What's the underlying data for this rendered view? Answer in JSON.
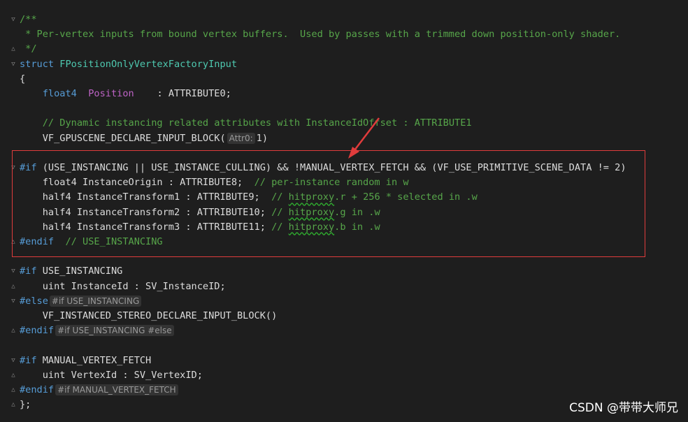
{
  "lines": [
    {
      "parts": [
        [
          "cm",
          "/**"
        ]
      ]
    },
    {
      "parts": [
        [
          "cm",
          " * Per-vertex inputs from bound vertex buffers.  Used by passes with a trimmed down position-only shader."
        ]
      ]
    },
    {
      "parts": [
        [
          "cm",
          " */"
        ]
      ]
    },
    {
      "parts": [
        [
          "kw",
          "struct"
        ],
        [
          "tx",
          " "
        ],
        [
          "ty",
          "FPositionOnlyVertexFactoryInput"
        ]
      ]
    },
    {
      "parts": [
        [
          "tx",
          "{"
        ]
      ]
    },
    {
      "parts": [
        [
          "tx",
          "    "
        ],
        [
          "kw",
          "float4"
        ],
        [
          "tx",
          "  "
        ],
        [
          "mac",
          "Position"
        ],
        [
          "tx",
          "    : ATTRIBUTE0;"
        ]
      ]
    },
    {
      "parts": [
        [
          "tx",
          ""
        ]
      ]
    },
    {
      "parts": [
        [
          "tx",
          "    "
        ],
        [
          "cm",
          "// Dynamic instancing related attributes with InstanceIdOffset : ATTRIBUTE1"
        ]
      ]
    },
    {
      "parts": [
        [
          "tx",
          "    VF_GPUSCENE_DECLARE_INPUT_BLOCK("
        ],
        [
          "hint",
          "Attr0:"
        ],
        [
          "tx",
          "1)"
        ]
      ]
    },
    {
      "parts": [
        [
          "tx",
          ""
        ]
      ]
    },
    {
      "parts": [
        [
          "kw",
          "#if"
        ],
        [
          "tx",
          " (USE_INSTANCING || USE_INSTANCE_CULLING) && !MANUAL_VERTEX_FETCH && (VF_USE_PRIMITIVE_SCENE_DATA != 2)"
        ]
      ]
    },
    {
      "parts": [
        [
          "tx",
          "    float4 InstanceOrigin : ATTRIBUTE8;  "
        ],
        [
          "cm",
          "// per-instance random in w"
        ]
      ]
    },
    {
      "parts": [
        [
          "tx",
          "    half4 InstanceTransform1 : ATTRIBUTE9;  "
        ],
        [
          "cm",
          "// "
        ],
        [
          "sq",
          "hitproxy"
        ],
        [
          "cm",
          ".r + 256 * selected in .w"
        ]
      ]
    },
    {
      "parts": [
        [
          "tx",
          "    half4 InstanceTransform2 : ATTRIBUTE10; "
        ],
        [
          "cm",
          "// "
        ],
        [
          "sq",
          "hitproxy"
        ],
        [
          "cm",
          ".g in .w"
        ]
      ]
    },
    {
      "parts": [
        [
          "tx",
          "    half4 InstanceTransform3 : ATTRIBUTE11; "
        ],
        [
          "cm",
          "// "
        ],
        [
          "sq",
          "hitproxy"
        ],
        [
          "cm",
          ".b in .w"
        ]
      ]
    },
    {
      "parts": [
        [
          "kw",
          "#endif"
        ],
        [
          "tx",
          "  "
        ],
        [
          "cm",
          "// USE_INSTANCING"
        ]
      ]
    },
    {
      "parts": [
        [
          "tx",
          ""
        ]
      ]
    },
    {
      "parts": [
        [
          "kw",
          "#if"
        ],
        [
          "tx",
          " USE_INSTANCING"
        ]
      ]
    },
    {
      "parts": [
        [
          "tx",
          "    uint InstanceId : SV_InstanceID;"
        ]
      ]
    },
    {
      "parts": [
        [
          "kw",
          "#else"
        ],
        [
          "hint",
          "#if USE_INSTANCING"
        ]
      ]
    },
    {
      "parts": [
        [
          "tx",
          "    VF_INSTANCED_STEREO_DECLARE_INPUT_BLOCK()"
        ]
      ]
    },
    {
      "parts": [
        [
          "kw",
          "#endif"
        ],
        [
          "hint",
          "#if USE_INSTANCING #else"
        ]
      ]
    },
    {
      "parts": [
        [
          "tx",
          ""
        ]
      ]
    },
    {
      "parts": [
        [
          "kw",
          "#if"
        ],
        [
          "tx",
          " MANUAL_VERTEX_FETCH"
        ]
      ]
    },
    {
      "parts": [
        [
          "tx",
          "    uint VertexId : SV_VertexID;"
        ]
      ]
    },
    {
      "parts": [
        [
          "kw",
          "#endif"
        ],
        [
          "hint",
          "#if MANUAL_VERTEX_FETCH"
        ]
      ]
    },
    {
      "parts": [
        [
          "tx",
          "};"
        ]
      ]
    }
  ],
  "folds": {
    "0": "open",
    "2": "close",
    "3": "open",
    "10": "open",
    "15": "close",
    "17": "open",
    "18": "close",
    "19": "open",
    "21": "close",
    "23": "open",
    "24": "close",
    "25": "close",
    "26": "close"
  },
  "watermark": "CSDN @带带大师兄",
  "colors": {
    "highlight_box": "#e03c3c",
    "arrow": "#e03c3c"
  }
}
